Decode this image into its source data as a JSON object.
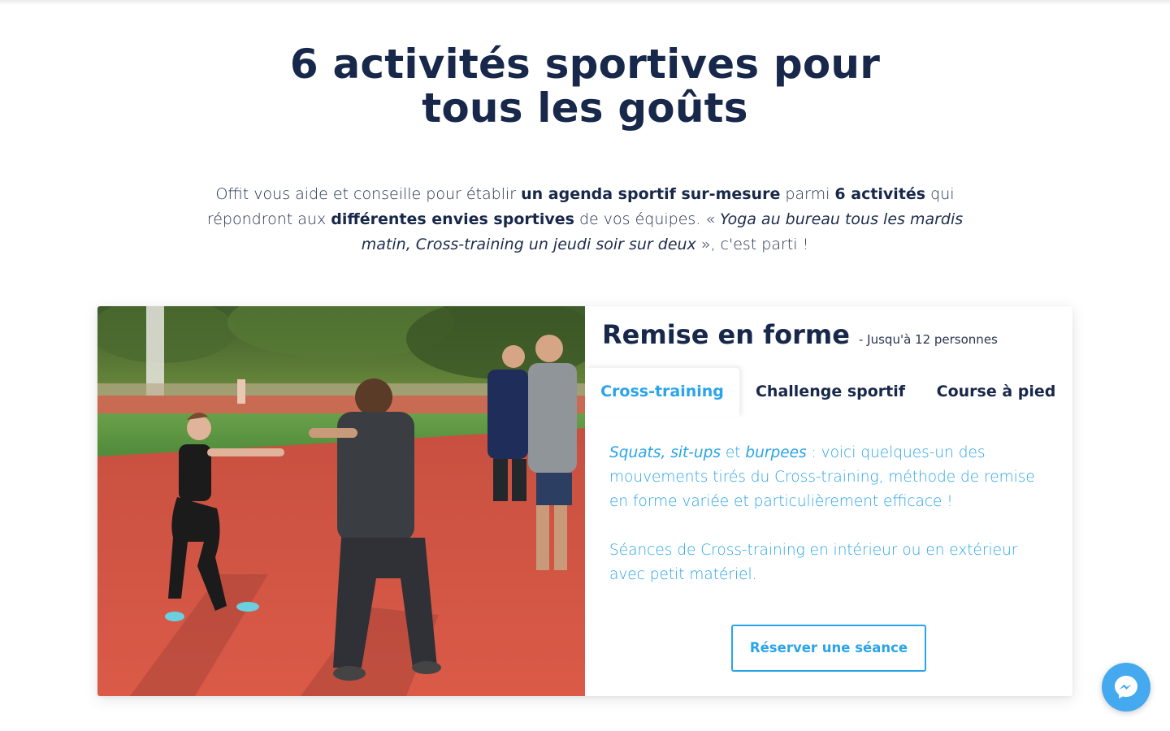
{
  "heading": {
    "line1": "6 activités sportives pour",
    "line2": "tous les goûts"
  },
  "intro": {
    "p1": "Offit vous aide et conseille pour établir ",
    "b1": "un agenda sportif sur-mesure",
    "p2": " parmi ",
    "b2": "6 activités",
    "p3": " qui répondront aux ",
    "b3": "différentes envies sportives",
    "p4": " de vos équipes. « ",
    "i1": "Yoga au bureau tous les mardis matin, Cross-training un jeudi soir sur deux",
    "p5": " », c'est parti !"
  },
  "card": {
    "title": "Remise en forme",
    "subtitle": "- Jusqu'à 12 personnes",
    "tabs": [
      {
        "label": "Cross-training",
        "active": true
      },
      {
        "label": "Challenge sportif",
        "active": false
      },
      {
        "label": "Course à pied",
        "active": false
      }
    ],
    "content": {
      "i1": "Squats, sit-ups",
      "t1": " et ",
      "i2": "burpees",
      "t2": " : voici quelques-un des mouvements tirés du Cross-training, méthode de remise en forme variée et particulièrement efficace !",
      "para2": "Séances de Cross-training en intérieur ou en extérieur avec petit matériel."
    },
    "cta_label": "Réserver une séance"
  },
  "messenger": {
    "icon": "messenger-icon"
  },
  "colors": {
    "navy": "#18284b",
    "accent": "#2aa4e8",
    "messenger": "#45a9ef",
    "track": "#d9574a"
  }
}
